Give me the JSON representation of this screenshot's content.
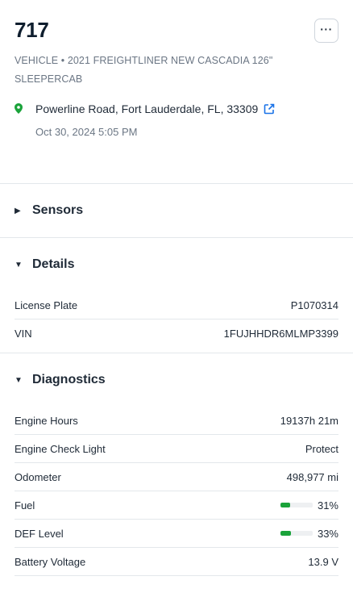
{
  "vehicle": {
    "name": "717",
    "subtitle": "VEHICLE • 2021 FREIGHTLINER NEW CASCADIA 126\" SLEEPERCAB",
    "address": "Powerline Road, Fort Lauderdale, FL, 33309",
    "timestamp": "Oct 30, 2024 5:05 PM",
    "more_label": "···"
  },
  "sections": {
    "sensors": {
      "title": "Sensors",
      "expanded": false,
      "caret": "▶"
    },
    "details": {
      "title": "Details",
      "expanded": true,
      "caret": "▼"
    },
    "diagnostics": {
      "title": "Diagnostics",
      "expanded": true,
      "caret": "▼"
    }
  },
  "details": [
    {
      "label": "License Plate",
      "value": "P1070314"
    },
    {
      "label": "VIN",
      "value": "1FUJHHDR6MLMP3399"
    }
  ],
  "diagnostics": [
    {
      "label": "Engine Hours",
      "value": "19137h 21m"
    },
    {
      "label": "Engine Check Light",
      "value": "Protect"
    },
    {
      "label": "Odometer",
      "value": "498,977 mi"
    },
    {
      "label": "Fuel",
      "value": "31%",
      "level": 0.31
    },
    {
      "label": "DEF Level",
      "value": "33%",
      "level": 0.33
    },
    {
      "label": "Battery Voltage",
      "value": "13.9 V"
    }
  ],
  "colors": {
    "accent": "#1a73e8",
    "pin": "#1aa33a",
    "bar_fill": "#1aa33a"
  },
  "icons": {
    "more": "more-horizontal-icon",
    "pin": "map-pin-icon",
    "external": "external-link-icon"
  }
}
